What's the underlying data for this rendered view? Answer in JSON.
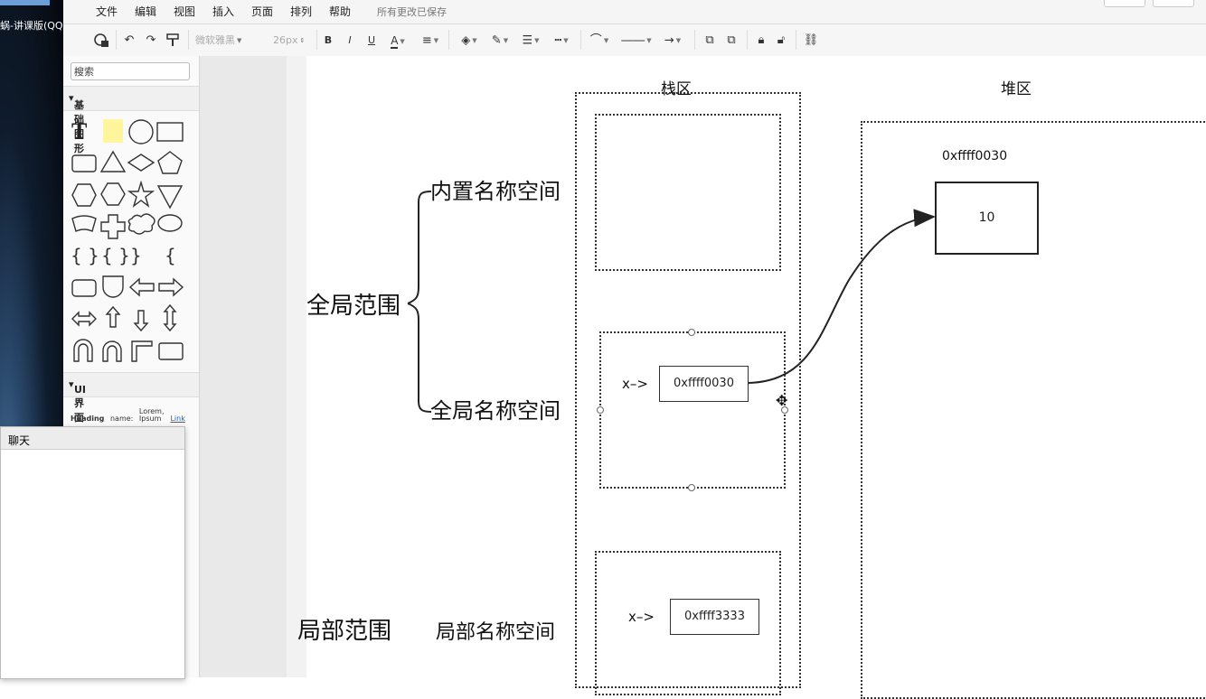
{
  "desktop": {
    "window_title": "蜗-讲课版(QQ"
  },
  "menubar": {
    "items": [
      "文件",
      "编辑",
      "视图",
      "插入",
      "页面",
      "排列",
      "帮助"
    ],
    "status": "所有更改已保存"
  },
  "toolbar": {
    "font_family": "微软雅黑",
    "font_size": "26px",
    "bold": "B",
    "italic": "I",
    "underline": "U",
    "font_color": "A"
  },
  "panel": {
    "search_placeholder": "搜索",
    "section_basic": "基础图形",
    "section_ui": "UI 界面元素",
    "ui_sample": {
      "heading": "Heading",
      "name": "name:",
      "lorem": "Lorem, Ipsum",
      "link": "Link"
    }
  },
  "chat": {
    "title": "聊天"
  },
  "diagram": {
    "stack_title": "栈区",
    "heap_title": "堆区",
    "global_scope": "全局范围",
    "builtin_ns": "内置名称空间",
    "global_ns": "全局名称空间",
    "local_scope": "局部范围",
    "local_ns": "局部名称空间",
    "x_arrow_1": "x–>",
    "x_arrow_2": "x–>",
    "addr_global": "0xffff0030",
    "addr_local": "0xffff3333",
    "heap_addr": "0xffff0030",
    "heap_value": "10"
  },
  "colors": {
    "link": "#1a5fd0",
    "note_yellow": "#fff59d",
    "canvas_gutter": "#e9e9e9"
  }
}
